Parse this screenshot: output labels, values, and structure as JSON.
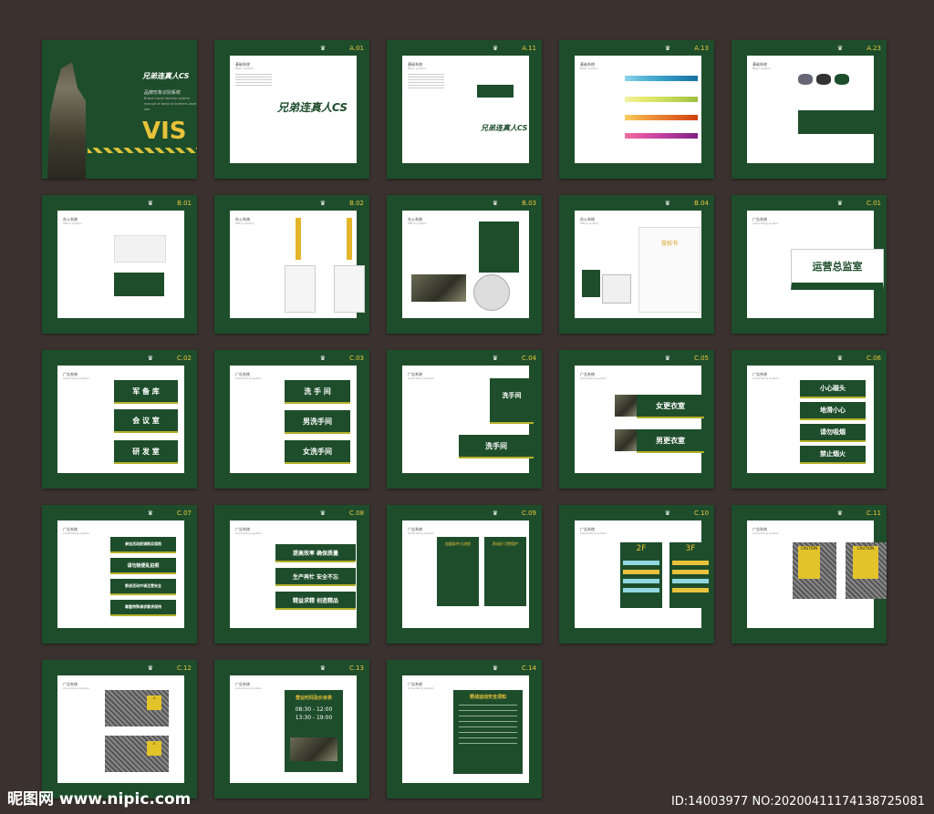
{
  "cover": {
    "title_cn": "品牌形象识别系统",
    "title_en": "Brand visual identity system manual of band of brothers laser war",
    "vis": "VIS",
    "logo_text": "兄弟连真人CS"
  },
  "pages": [
    {
      "code": "A.01",
      "section": "基础系统",
      "section_en": "Basic system"
    },
    {
      "code": "A.11",
      "section": "基础系统",
      "section_en": "Basic system"
    },
    {
      "code": "A.13",
      "section": "基础系统",
      "section_en": "Basic system"
    },
    {
      "code": "A.23",
      "section": "基础系统",
      "section_en": "Basic system"
    },
    {
      "code": "B.01",
      "section": "办公系统",
      "section_en": "Office system"
    },
    {
      "code": "B.02",
      "section": "办公系统",
      "section_en": "Office system"
    },
    {
      "code": "B.03",
      "section": "办公系统",
      "section_en": "Office system"
    },
    {
      "code": "B.04",
      "section": "办公系统",
      "section_en": "Office system"
    },
    {
      "code": "C.01",
      "section": "广告系统",
      "section_en": "Advertising system"
    },
    {
      "code": "C.02",
      "section": "广告系统",
      "section_en": "Advertising system"
    },
    {
      "code": "C.03",
      "section": "广告系统",
      "section_en": "Advertising system"
    },
    {
      "code": "C.04",
      "section": "广告系统",
      "section_en": "Advertising system"
    },
    {
      "code": "C.05",
      "section": "广告系统",
      "section_en": "Advertising system"
    },
    {
      "code": "C.06",
      "section": "广告系统",
      "section_en": "Advertising system"
    },
    {
      "code": "C.07",
      "section": "广告系统",
      "section_en": "Advertising system"
    },
    {
      "code": "C.08",
      "section": "广告系统",
      "section_en": "Advertising system"
    },
    {
      "code": "C.09",
      "section": "广告系统",
      "section_en": "Advertising system"
    },
    {
      "code": "C.10",
      "section": "广告系统",
      "section_en": "Advertising system"
    },
    {
      "code": "C.11",
      "section": "广告系统",
      "section_en": "Advertising system"
    },
    {
      "code": "C.12",
      "section": "广告系统",
      "section_en": "Advertising system"
    },
    {
      "code": "C.13",
      "section": "广告系统",
      "section_en": "Advertising system"
    },
    {
      "code": "C.14",
      "section": "广告系统",
      "section_en": "Advertising system"
    }
  ],
  "signs": {
    "b04_award": "授权书",
    "c01_office": "运营总监室",
    "c02": [
      "军 备 库",
      "会 议 室",
      "研 发 室"
    ],
    "c03": [
      "洗 手 间",
      "男洗手间",
      "女洗手间"
    ],
    "c04": [
      "洗手间",
      "洗手间"
    ],
    "c05": [
      "女更衣室",
      "男更衣室"
    ],
    "c06": [
      "小心碰头",
      "地滑小心",
      "请勿吸烟",
      "禁止烟火"
    ],
    "c07": [
      "参加活动前请购买保险",
      "请勿随便乱拍照",
      "野战活动中请注意安全",
      "尊重特殊请求要求保持"
    ],
    "c08": [
      "提高效率 确保质量",
      "生产再忙 安全不忘",
      "精益求精 创造精品"
    ],
    "c09": [
      "加盟条件与流程",
      "养成好习惯保护"
    ],
    "c10": [
      "2F",
      "3F"
    ],
    "c11": [
      "CAUTION",
      "CAUTION"
    ],
    "c13": {
      "title": "营业时间及价目表",
      "t1": "08:30 - 12:00",
      "t2": "13:30 - 19:00"
    },
    "c14": {
      "title": "野战运动安全须知"
    }
  },
  "watermark": {
    "left": "昵图网 www.nipic.com",
    "right": "ID:14003977 NO:20200411174138725081"
  },
  "colors": {
    "brand_green": "#1e4d2b",
    "brand_yellow": "#e8c23a",
    "background": "#3b3230"
  }
}
